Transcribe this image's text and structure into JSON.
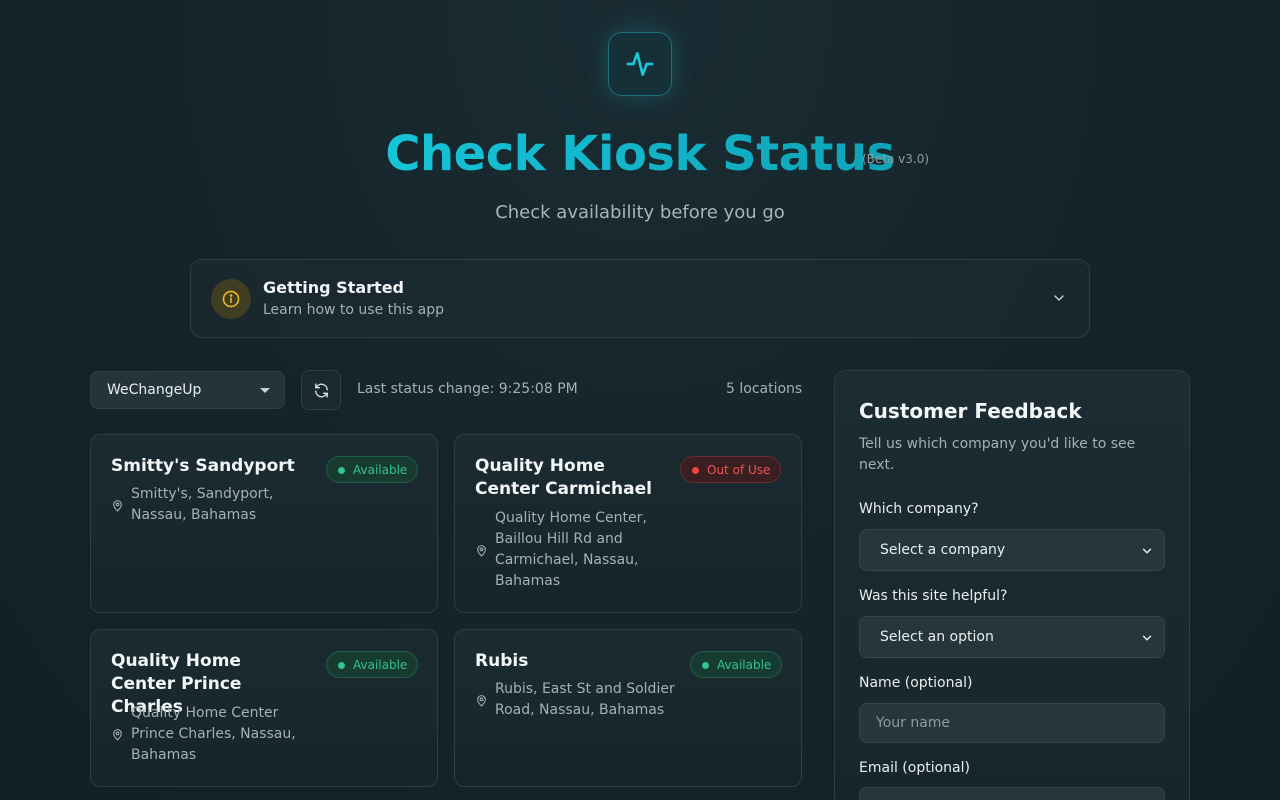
{
  "header": {
    "title": "Check Kiosk Status",
    "beta": "(Beta v3.0)",
    "subtitle": "Check availability before you go"
  },
  "getting_started": {
    "title": "Getting Started",
    "subtitle": "Learn how to use this app"
  },
  "toolbar": {
    "company_selected": "WeChangeUp",
    "last_change": "Last status change: 9:25:08 PM",
    "location_count": "5 locations"
  },
  "kiosks": [
    {
      "name": "Smitty's Sandyport",
      "status": "Available",
      "address": "Smitty's, Sandyport, Nassau, Bahamas"
    },
    {
      "name": "Quality Home Center Carmichael",
      "status": "Out of Use",
      "address": "Quality Home Center, Baillou Hill Rd and Carmichael, Nassau, Bahamas"
    },
    {
      "name": "Quality Home Center Prince Charles",
      "status": "Available",
      "address": "Quality Home Center Prince Charles, Nassau, Bahamas"
    },
    {
      "name": "Rubis",
      "status": "Available",
      "address": "Rubis, East St and Soldier Road, Nassau, Bahamas"
    }
  ],
  "feedback": {
    "title": "Customer Feedback",
    "subtitle": "Tell us which company you'd like to see next.",
    "company_label": "Which company?",
    "company_value": "Select a company",
    "helpful_label": "Was this site helpful?",
    "helpful_value": "Select an option",
    "name_label": "Name (optional)",
    "name_placeholder": "Your name",
    "email_label": "Email (optional)"
  },
  "colors": {
    "accent": "#16c4d8",
    "available": "#33c48a",
    "out_of_use": "#ef4444",
    "background": "#14232a"
  }
}
